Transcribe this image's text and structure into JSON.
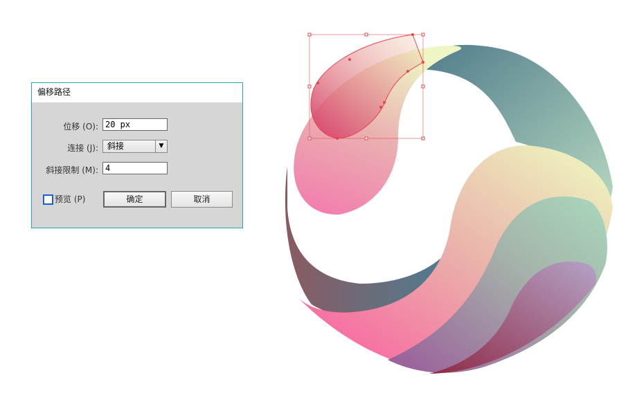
{
  "dialog": {
    "title": "偏移路径",
    "offset": {
      "label": "位移 (O):",
      "value": "20 px"
    },
    "joins": {
      "label": "连接 (J):",
      "value": "斜接"
    },
    "miter_limit": {
      "label": "斜接限制 (M):",
      "value": "4"
    },
    "preview": {
      "label": "预览 (P)",
      "checked": false
    },
    "ok_label": "确定",
    "cancel_label": "取消"
  },
  "colors": {
    "dialog_border": "#2aa3b8",
    "selection": "#e8434f"
  },
  "icons": {
    "dropdown": "triangle-down-icon"
  }
}
